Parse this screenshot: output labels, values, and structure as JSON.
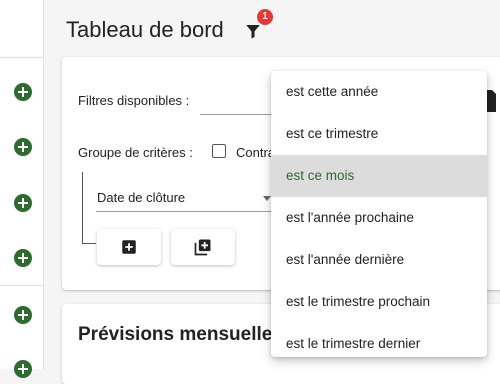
{
  "header": {
    "title": "Tableau de bord",
    "filter_badge_count": "1"
  },
  "filters": {
    "available_label": "Filtres disponibles :",
    "criteria_group_label": "Groupe de critères :",
    "checkbox_label_partial": "Contra",
    "field_value": "Date de clôture"
  },
  "sections": {
    "monthly_title": "Prévisions mensuelles"
  },
  "dropdown": {
    "options": [
      "est cette année",
      "est ce trimestre",
      "est ce mois",
      "est l'année prochaine",
      "est l'année dernière",
      "est le trimestre prochain",
      "est le trimestre dernier"
    ],
    "selected": "est ce mois"
  },
  "colors": {
    "accent": "#2e6b2f",
    "badge": "#e53935",
    "selected_bg": "#dcdcdc"
  },
  "icons": {
    "sidebar_add": "add-circle-icon",
    "filter": "filter-icon",
    "add": "add-box-icon",
    "add_group": "library-add-icon"
  }
}
